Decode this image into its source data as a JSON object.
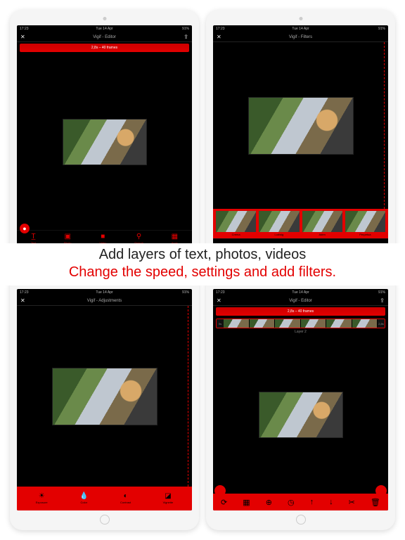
{
  "statusbar": {
    "time": "17:23",
    "date": "Tue 14 Apr",
    "battery": "91%"
  },
  "caption": {
    "line1": "Add layers of text, photos, videos",
    "line2": "Change the speed, settings and add filters."
  },
  "colors": {
    "accent": "#e30000"
  },
  "ipads": {
    "editor": {
      "title": "Vigif - Editor",
      "frames_label": "2,8s – 40 frames",
      "toolbar": [
        {
          "icon": "T",
          "label": "Text"
        },
        {
          "icon": "▣",
          "label": "Photo"
        },
        {
          "icon": "■",
          "label": "Video"
        },
        {
          "icon": "⚲",
          "label": "Search"
        },
        {
          "icon": "▦",
          "label": "Apps"
        }
      ]
    },
    "filters": {
      "title": "Vigif - Filters",
      "items": [
        {
          "label": "Crema"
        },
        {
          "label": "Ludwig"
        },
        {
          "label": "Aden"
        },
        {
          "label": "Perpetua"
        }
      ]
    },
    "adjustments": {
      "title": "Vigif - Adjustments",
      "items": [
        {
          "icon": "☀",
          "label": "Exposure"
        },
        {
          "icon": "●",
          "label": "Color"
        },
        {
          "icon": "◐",
          "label": "Contrast"
        },
        {
          "icon": "◪",
          "label": "Vignette"
        }
      ]
    },
    "layers": {
      "title": "Vigif - Editor",
      "frames_label": "2,8s – 40 frames",
      "layer_label": "Layer 2",
      "timeline": {
        "start": "0s",
        "end": "2,8s"
      },
      "icons": [
        {
          "name": "loop-icon",
          "glyph": "⟳"
        },
        {
          "name": "grid-icon",
          "glyph": "▦"
        },
        {
          "name": "globe-icon",
          "glyph": "⊕"
        },
        {
          "name": "clock-icon",
          "glyph": "◷"
        },
        {
          "name": "up-icon",
          "glyph": "↑"
        },
        {
          "name": "down-icon",
          "glyph": "↓"
        },
        {
          "name": "cut-icon",
          "glyph": "✂"
        },
        {
          "name": "trash-icon",
          "glyph": "🗑"
        }
      ]
    }
  }
}
